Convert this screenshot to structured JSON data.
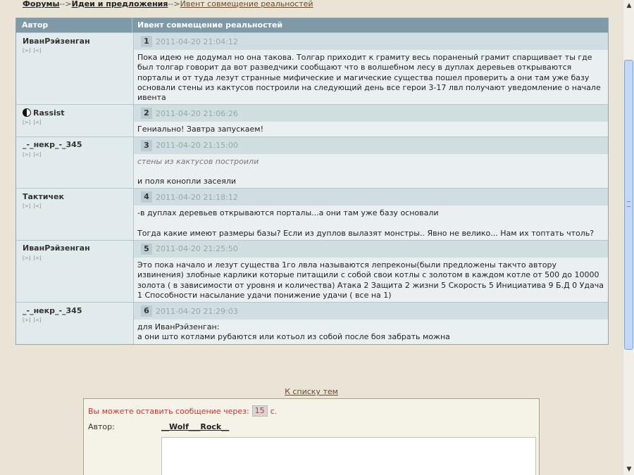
{
  "breadcrumb": {
    "forums": "Форумы",
    "sep1": "-->",
    "ideas": "Идеи и предложения",
    "sep2": "-->",
    "current": "Ивент совмещение реальностей"
  },
  "table": {
    "col_author": "Автор",
    "col_topic": "Ивент совмещение реальностей"
  },
  "posts": [
    {
      "author": "ИванРэйзенган",
      "num": "1",
      "date": "2011-04-20 21:04:12",
      "text": "Пока идею не додумал но она такова. Толгар приходит к грамиту весь пораненый грамит спарщивает ты где был толгар говорит да вот разведчики сообщают что в волшебном лесу в дуплах деревьев открываются порталы и от туда лезут странные мифические и магические существа пошел проверить а они там уже базу основали стены из кактусов построили на следующий день все герои 3-17 лвл получают уведомление о начале ивента"
    },
    {
      "author": "Rassist",
      "num": "2",
      "date": "2011-04-20 21:06:26",
      "text": "Гениально! Завтра запускаем!"
    },
    {
      "author": "_-_некр_-_345",
      "num": "3",
      "date": "2011-04-20 21:15:00",
      "quote": "стены из кактусов построили",
      "text": "и поля конопли засеяли"
    },
    {
      "author": "Тактичек",
      "num": "4",
      "date": "2011-04-20 21:18:12",
      "text": "-в дуплах деревьев открываются порталы...а они там уже базу основали",
      "text2": "Тогда какие имеют размеры базы? Если из дуплов вылазят монстры.. Явно не велико... Нам их топтать чтоль?"
    },
    {
      "author": "ИванРэйзенган",
      "num": "5",
      "date": "2011-04-20 21:25:50",
      "text": "Это пока начало и лезут существа 1го лвла называются лепреконы(были предложены такчто автору извинения) злобные карлики которые питащили с собой свои котлы с золотом в каждом котле от 500 до 10000 золота ( в зависимости от уровня и количества) Атака 2 Защита 2 жизни 5 Скорость 5 Инициатива 9 Б.Д 0 Удача 1 Способности насылание удачи понижение удачи ( все на 1)"
    },
    {
      "author": "_-_некр_-_345",
      "num": "6",
      "date": "2011-04-20 21:29:03",
      "text": "для ИванРэйзенган:",
      "text2": "а они што котлами рубаются или котьол из собой после боя забрать можна"
    }
  ],
  "post_actions": {
    "profile": "[>]",
    "reply": "[<]"
  },
  "back_link": "К списку тем",
  "form": {
    "wait_before": "Вы можете оставить сообщение через:",
    "wait_count": "15",
    "wait_after": "с.",
    "author_label": "Автор:",
    "author_value": "__Wolf___Rock__"
  },
  "icons": {
    "yin_yang": "yin-yang-icon",
    "scroll_up": "arrow-up-icon",
    "scroll_down": "arrow-down-icon"
  }
}
